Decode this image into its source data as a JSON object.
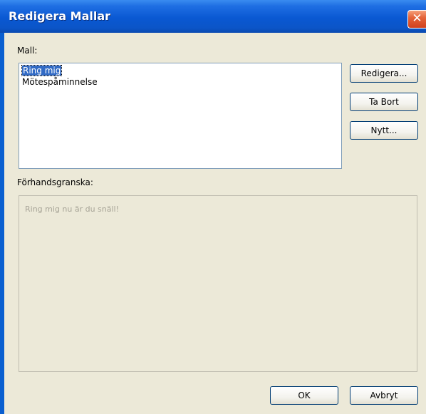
{
  "window": {
    "title": "Redigera Mallar",
    "close_glyph": "✕"
  },
  "template_section": {
    "label": "Mall:",
    "items": [
      {
        "label": "Ring mig",
        "selected": true
      },
      {
        "label": "Mötespåminnelse",
        "selected": false
      }
    ]
  },
  "actions": {
    "edit_label": "Redigera...",
    "delete_label": "Ta Bort",
    "new_label": "Nytt..."
  },
  "preview_section": {
    "label": "Förhandsgranska:",
    "text": "Ring mig nu är du snäll!"
  },
  "footer": {
    "ok_label": "OK",
    "cancel_label": "Avbryt"
  },
  "colors": {
    "titlebar": "#0a58d2",
    "selection": "#316ac5",
    "dialog_background": "#ece9d8",
    "close_button": "#e5643a"
  }
}
